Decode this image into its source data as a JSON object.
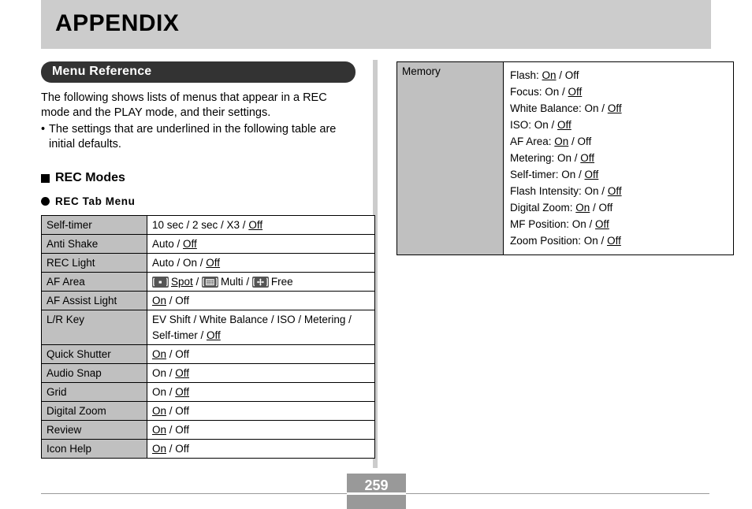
{
  "header": {
    "title": "APPENDIX"
  },
  "section": {
    "banner_label": "Menu Reference",
    "intro_paragraph": "The following shows lists of menus that appear in a REC mode and the PLAY mode, and their settings.",
    "intro_bullet_marker": "•",
    "intro_bullet": "The settings that are underlined in the following table are initial defaults."
  },
  "headings": {
    "rec_modes": "REC Modes",
    "rec_tab_menu": "REC Tab Menu"
  },
  "rec_tab_table": {
    "rows": [
      {
        "label": "Self-timer",
        "lines": [
          [
            {
              "t": "10 sec / 2 sec / X3 / ",
              "u": false
            },
            {
              "t": "Off",
              "u": true
            }
          ]
        ]
      },
      {
        "label": "Anti Shake",
        "lines": [
          [
            {
              "t": "Auto / ",
              "u": false
            },
            {
              "t": "Off",
              "u": true
            }
          ]
        ]
      },
      {
        "label": "REC Light",
        "lines": [
          [
            {
              "t": "Auto / On / ",
              "u": false
            },
            {
              "t": "Off",
              "u": true
            }
          ]
        ]
      },
      {
        "label": "AF Area",
        "icons": true,
        "icon_items": [
          {
            "icon": "af-spot-icon",
            "text": "Spot",
            "underline": true,
            "sep": " / "
          },
          {
            "icon": "af-multi-icon",
            "text": "Multi",
            "underline": false,
            "sep": " / "
          },
          {
            "icon": "af-free-icon",
            "text": "Free",
            "underline": false,
            "sep": ""
          }
        ]
      },
      {
        "label": "AF Assist Light",
        "lines": [
          [
            {
              "t": "On",
              "u": true
            },
            {
              "t": " / Off",
              "u": false
            }
          ]
        ]
      },
      {
        "label": "L/R Key",
        "lines": [
          [
            {
              "t": "EV Shift / White Balance / ISO / Metering /",
              "u": false
            }
          ],
          [
            {
              "t": "Self-timer / ",
              "u": false
            },
            {
              "t": "Off",
              "u": true
            }
          ]
        ]
      },
      {
        "label": "Quick Shutter",
        "lines": [
          [
            {
              "t": "On",
              "u": true
            },
            {
              "t": " / Off",
              "u": false
            }
          ]
        ]
      },
      {
        "label": "Audio Snap",
        "lines": [
          [
            {
              "t": "On / ",
              "u": false
            },
            {
              "t": "Off",
              "u": true
            }
          ]
        ]
      },
      {
        "label": "Grid",
        "lines": [
          [
            {
              "t": "On / ",
              "u": false
            },
            {
              "t": "Off",
              "u": true
            }
          ]
        ]
      },
      {
        "label": "Digital Zoom",
        "lines": [
          [
            {
              "t": "On",
              "u": true
            },
            {
              "t": " / Off",
              "u": false
            }
          ]
        ]
      },
      {
        "label": "Review",
        "lines": [
          [
            {
              "t": "On",
              "u": true
            },
            {
              "t": " / Off",
              "u": false
            }
          ]
        ]
      },
      {
        "label": "Icon Help",
        "lines": [
          [
            {
              "t": "On",
              "u": true
            },
            {
              "t": " / Off",
              "u": false
            }
          ]
        ]
      }
    ]
  },
  "memory_table": {
    "label": "Memory",
    "lines": [
      [
        {
          "t": "Flash: ",
          "u": false
        },
        {
          "t": "On",
          "u": true
        },
        {
          "t": " / Off",
          "u": false
        }
      ],
      [
        {
          "t": "Focus: On / ",
          "u": false
        },
        {
          "t": "Off",
          "u": true
        }
      ],
      [
        {
          "t": "White Balance: On / ",
          "u": false
        },
        {
          "t": "Off",
          "u": true
        }
      ],
      [
        {
          "t": "ISO: On / ",
          "u": false
        },
        {
          "t": "Off",
          "u": true
        }
      ],
      [
        {
          "t": "AF Area: ",
          "u": false
        },
        {
          "t": "On",
          "u": true
        },
        {
          "t": " / Off",
          "u": false
        }
      ],
      [
        {
          "t": "Metering: On / ",
          "u": false
        },
        {
          "t": "Off",
          "u": true
        }
      ],
      [
        {
          "t": "Self-timer: On / ",
          "u": false
        },
        {
          "t": "Off",
          "u": true
        }
      ],
      [
        {
          "t": "Flash Intensity: On / ",
          "u": false
        },
        {
          "t": "Off",
          "u": true
        }
      ],
      [
        {
          "t": "Digital Zoom: ",
          "u": false
        },
        {
          "t": "On",
          "u": true
        },
        {
          "t": " / Off",
          "u": false
        }
      ],
      [
        {
          "t": "MF Position: On / ",
          "u": false
        },
        {
          "t": "Off",
          "u": true
        }
      ],
      [
        {
          "t": "Zoom Position: On / ",
          "u": false
        },
        {
          "t": "Off",
          "u": true
        }
      ]
    ]
  },
  "footer": {
    "page_number": "259"
  },
  "colors": {
    "header_band": "#cccccc",
    "banner": "#333333",
    "table_label_cell": "#c0c0c0",
    "page_number_box": "#999999",
    "divider": "#cccccc",
    "icon_chip": "#555555"
  }
}
